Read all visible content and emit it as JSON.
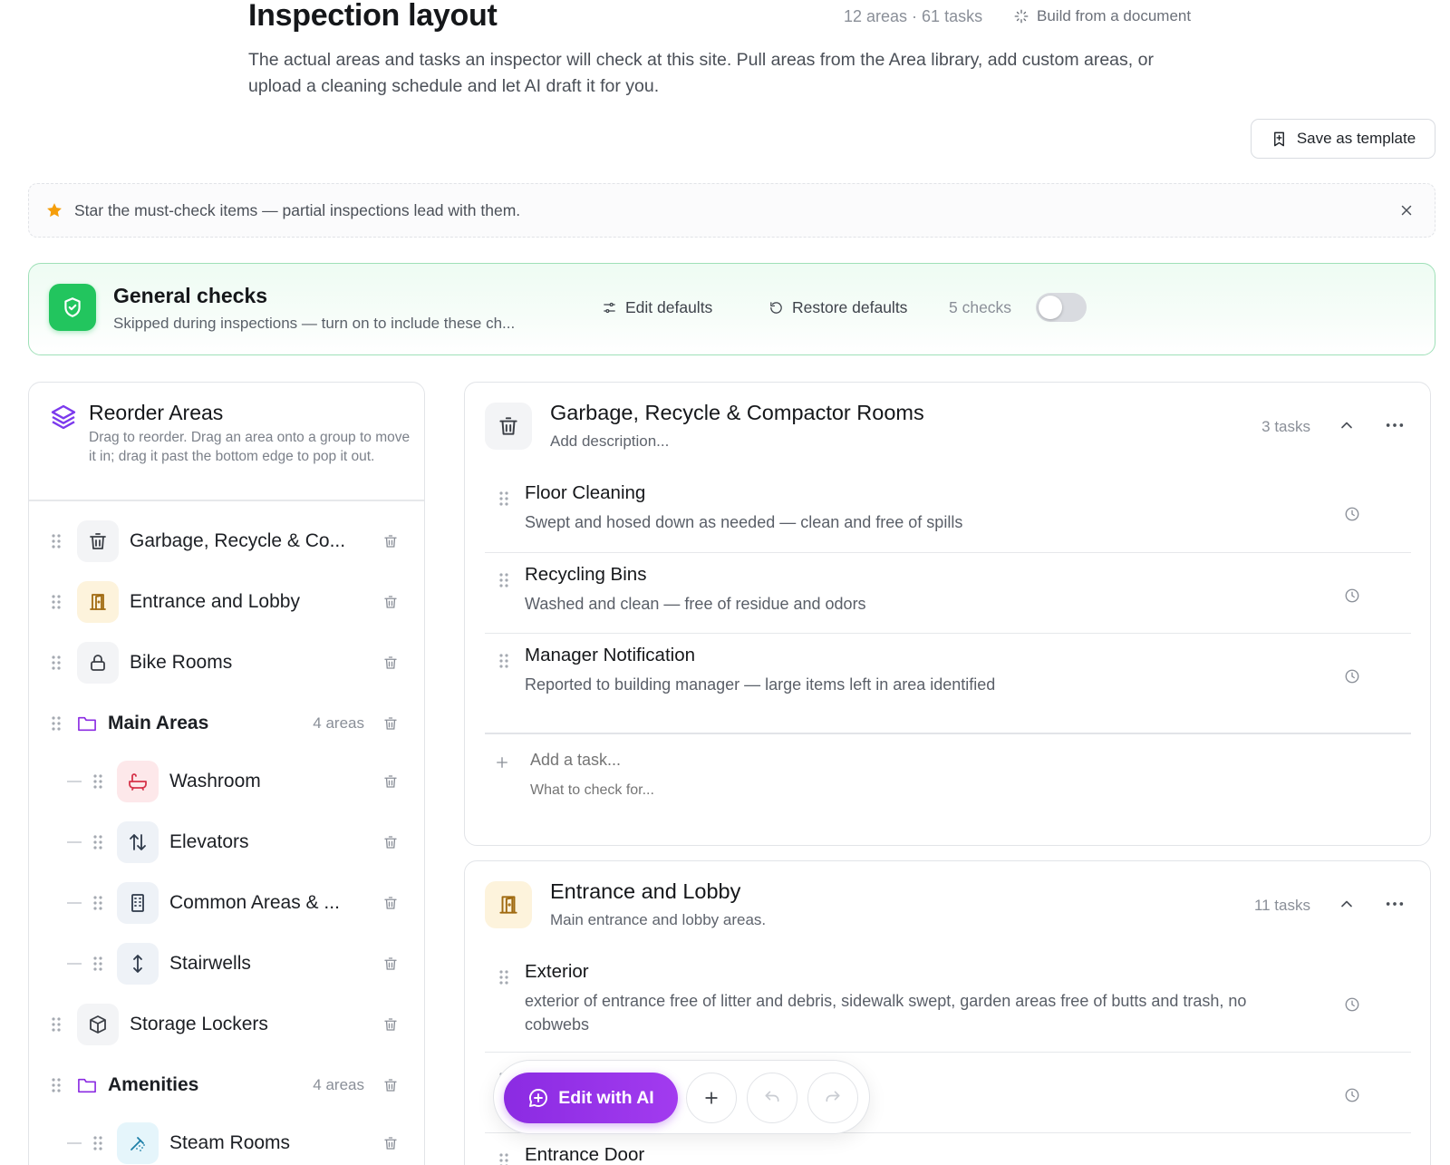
{
  "header": {
    "title": "Inspection layout",
    "meta": "12 areas · 61 tasks",
    "build_from_document": "Build from a document",
    "description": "The actual areas and tasks an inspector will check at this site. Pull areas from the Area library, add custom areas, or upload a cleaning schedule and let AI draft it for you.",
    "save_template": "Save as template"
  },
  "tip": {
    "text": "Star the must-check items — partial inspections lead with them."
  },
  "general_checks": {
    "title": "General checks",
    "subtitle": "Skipped during inspections — turn on to include these ch...",
    "edit_defaults": "Edit defaults",
    "restore_defaults": "Restore defaults",
    "count": "5 checks",
    "enabled": false
  },
  "reorder": {
    "title": "Reorder Areas",
    "subtitle": "Drag to reorder. Drag an area onto a group to move it in; drag it past the bottom edge to pop it out.",
    "items": [
      {
        "label": "Garbage, Recycle & Co...",
        "icon": "trash-icon"
      },
      {
        "label": "Entrance and Lobby",
        "icon": "door-icon"
      },
      {
        "label": "Bike Rooms",
        "icon": "lock-icon"
      },
      {
        "label": "Main Areas",
        "icon": "folder-icon",
        "count": "4 areas"
      },
      {
        "label": "Washroom",
        "icon": "bathtub-icon"
      },
      {
        "label": "Elevators",
        "icon": "arrows-up-down-icon"
      },
      {
        "label": "Common Areas & ...",
        "icon": "building-icon"
      },
      {
        "label": "Stairwells",
        "icon": "arrow-vertical-icon"
      },
      {
        "label": "Storage Lockers",
        "icon": "box-icon"
      },
      {
        "label": "Amenities",
        "icon": "folder-icon",
        "count": "4 areas"
      },
      {
        "label": "Steam Rooms",
        "icon": "shower-icon"
      }
    ]
  },
  "cards": [
    {
      "title": "Garbage, Recycle & Compactor Rooms",
      "description": "Add description...",
      "count": "3 tasks",
      "tasks": [
        {
          "title": "Floor Cleaning",
          "desc": "Swept and hosed down as needed — clean and free of spills"
        },
        {
          "title": "Recycling Bins",
          "desc": "Washed and clean — free of residue and odors"
        },
        {
          "title": "Manager Notification",
          "desc": "Reported to building manager — large items left in area identified"
        }
      ],
      "add_task_placeholder": "Add a task...",
      "add_desc_placeholder": "What to check for..."
    },
    {
      "title": "Entrance and Lobby",
      "description": "Main entrance and lobby areas.",
      "count": "11 tasks",
      "tasks": [
        {
          "title": "Exterior",
          "desc": "exterior of entrance free of litter and debris, sidewalk swept, garden areas free of butts and trash, no cobwebs"
        },
        {
          "title": "Entrance Door",
          "desc": ""
        }
      ]
    }
  ],
  "fab": {
    "edit_ai": "Edit with AI"
  },
  "colors": {
    "accent_purple": "#8b2be2",
    "green": "#22c55e",
    "star": "#f59e0b"
  }
}
